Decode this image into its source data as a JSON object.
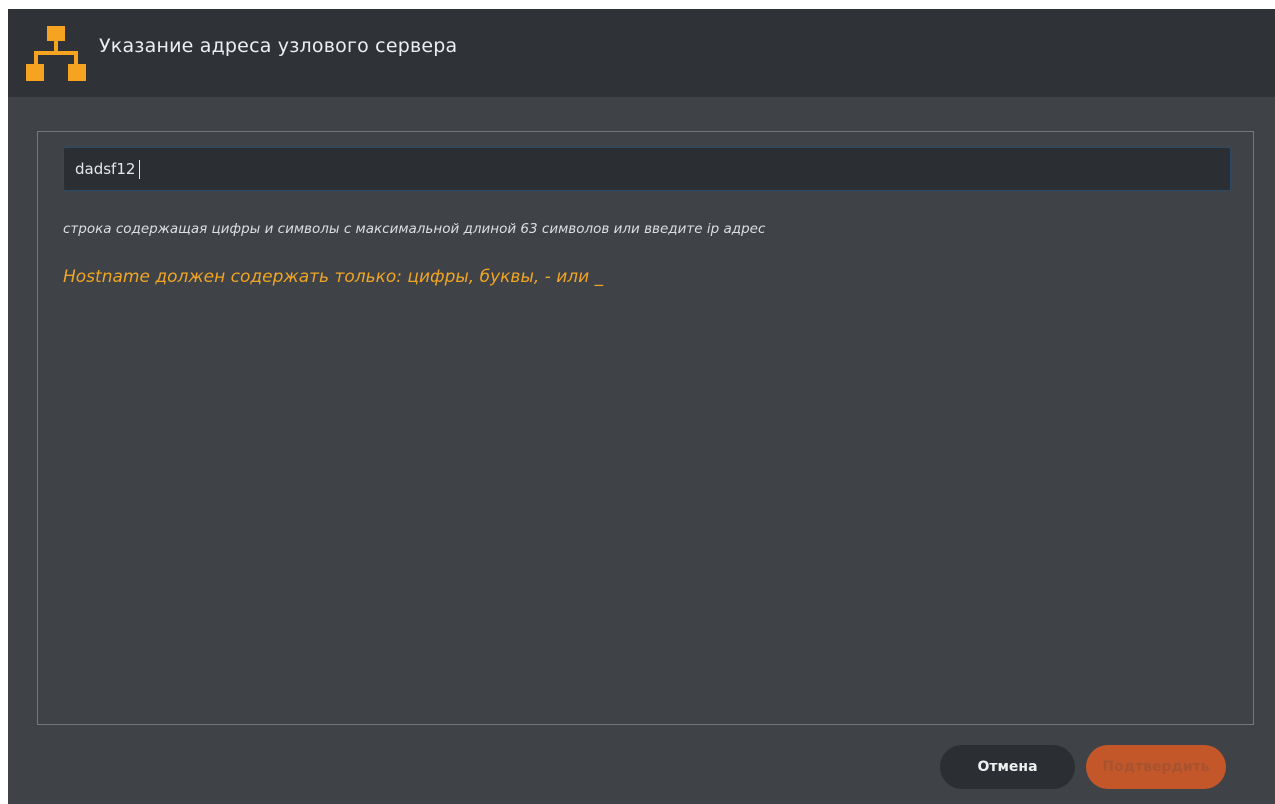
{
  "dialog": {
    "title": "Указание адреса узлового сервера",
    "icon": "network-topology-icon",
    "accent_color": "#f5a320"
  },
  "hostname_input": {
    "value": "dadsf12"
  },
  "hint_text": "строка содержащая цифры и символы с максимальной длиной 63 символов или введите ip адрес",
  "error_text": "Hostname должен содержать только: цифры, буквы, - или _",
  "error_color": "#f0a523",
  "buttons": {
    "cancel_label": "Отмена",
    "confirm_label": "Подтвердить",
    "confirm_enabled": false,
    "confirm_color": "#c4572a"
  }
}
